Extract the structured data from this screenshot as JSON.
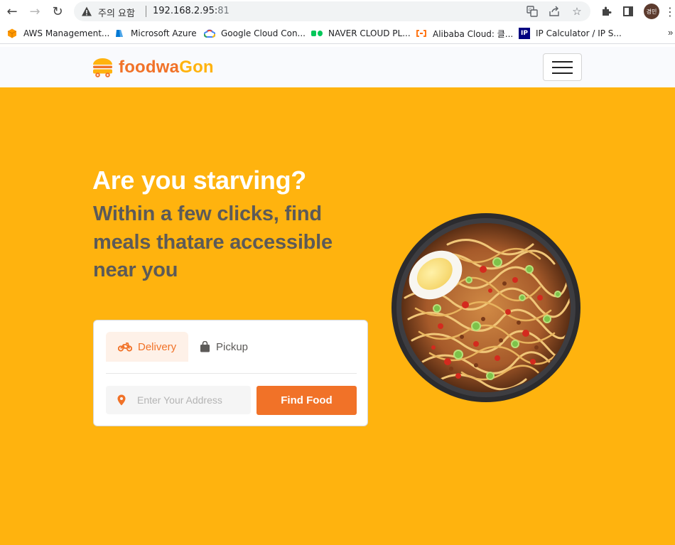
{
  "browser": {
    "security_label": "주의 요함",
    "url_host": "192.168.2.95:",
    "url_port": "81",
    "profile_initials": "경민",
    "bookmarks": [
      {
        "label": "AWS Management...",
        "icon": "aws-icon",
        "color": "#ff9900"
      },
      {
        "label": "Microsoft Azure",
        "icon": "azure-icon",
        "color": "#0078d4"
      },
      {
        "label": "Google Cloud Con...",
        "icon": "google-cloud-icon",
        "color": "#4285f4"
      },
      {
        "label": "NAVER CLOUD PL...",
        "icon": "naver-cloud-icon",
        "color": "#03c75a"
      },
      {
        "label": "Alibaba Cloud: 클...",
        "icon": "alibaba-cloud-icon",
        "color": "#ff6a00"
      },
      {
        "label": "IP Calculator / IP S...",
        "icon": "ip-calculator-icon",
        "color": "#000080"
      }
    ],
    "more_bookmarks": "»"
  },
  "site": {
    "logo_part1": "foodwa",
    "logo_part2": "Gon",
    "brand_color": "#f17228",
    "accent_color": "#ffb30e"
  },
  "hero": {
    "title": "Are you starving?",
    "subtitle": "Within a few clicks, find meals thatare accessible near you",
    "tabs": [
      {
        "label": "Delivery",
        "icon": "motorbike-icon",
        "active": true
      },
      {
        "label": "Pickup",
        "icon": "shopping-bag-icon",
        "active": false
      }
    ],
    "address_placeholder": "Enter Your Address",
    "find_button": "Find Food"
  }
}
